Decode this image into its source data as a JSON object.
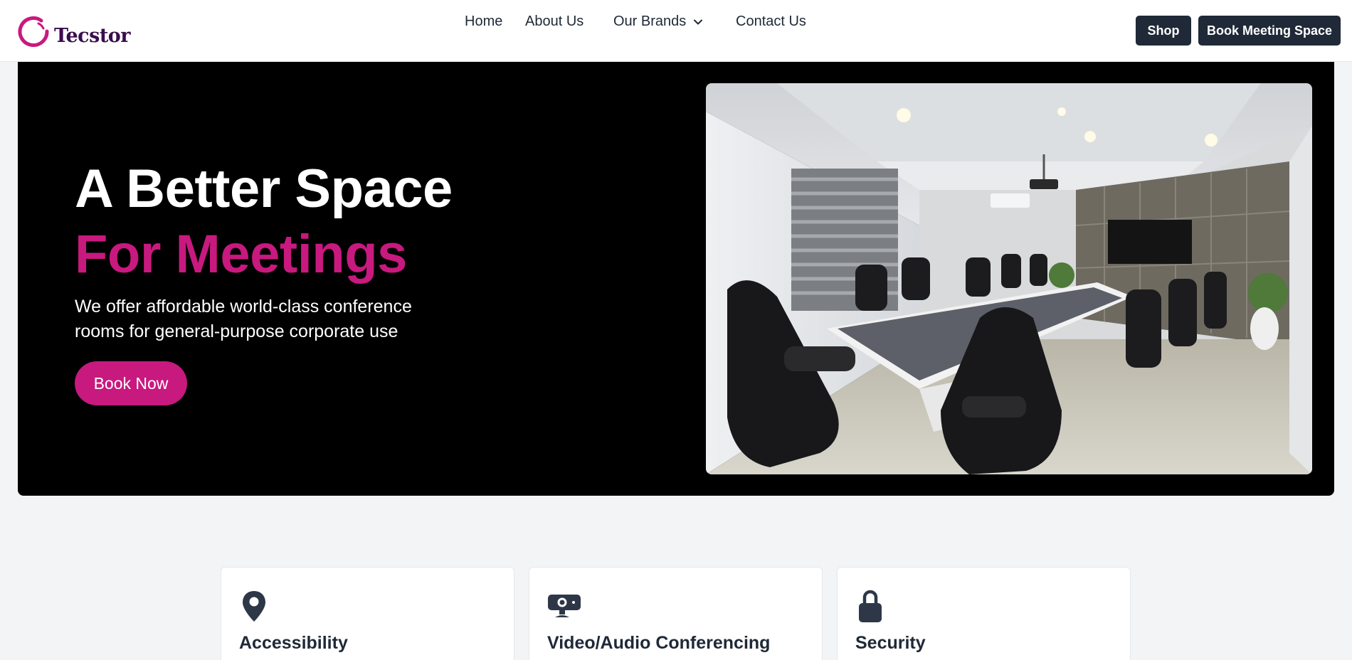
{
  "brand": {
    "name": "Tecstor",
    "accent": "#c8197f",
    "logo_color": "#3b0d4d"
  },
  "nav": {
    "items": [
      "Home",
      "About Us",
      "Our Brands",
      "Contact Us"
    ]
  },
  "header_buttons": {
    "shop": "Shop",
    "book_meeting_space": "Book Meeting Space"
  },
  "hero": {
    "title_line1": "A Better Space",
    "title_line2": "For Meetings",
    "subtitle": "We offer affordable world-class conference rooms for general-purpose corporate use",
    "cta": "Book Now",
    "image": "conference-room-photo"
  },
  "features": [
    {
      "icon": "map-pin-icon",
      "title": "Accessibility"
    },
    {
      "icon": "projector-icon",
      "title": "Video/Audio Conferencing"
    },
    {
      "icon": "lock-icon",
      "title": "Security"
    }
  ],
  "colors": {
    "dark_button": "#1f2937",
    "hero_bg": "#000000",
    "page_bg": "#f3f4f6"
  }
}
